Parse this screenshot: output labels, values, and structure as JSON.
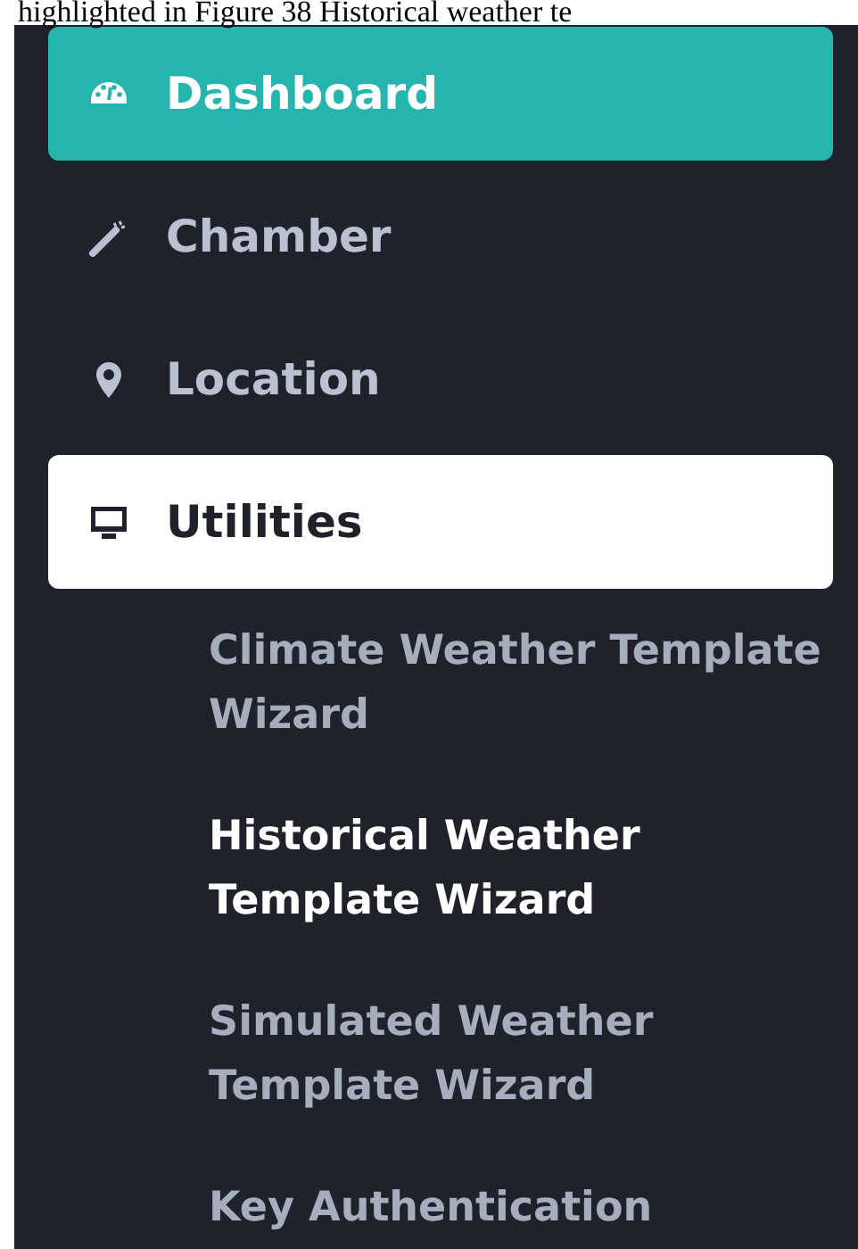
{
  "caption": "highlighted in Figure 38 Historical weather te",
  "sidebar": {
    "items": [
      {
        "label": "Dashboard",
        "selected": true,
        "expanded": false
      },
      {
        "label": "Chamber",
        "selected": false,
        "expanded": false
      },
      {
        "label": "Location",
        "selected": false,
        "expanded": false
      },
      {
        "label": "Utilities",
        "selected": false,
        "expanded": true,
        "children": [
          {
            "label": "Climate Weather Template Wizard",
            "selected": false
          },
          {
            "label": "Historical Weather Template Wizard",
            "selected": true
          },
          {
            "label": "Simulated Weather Template Wizard",
            "selected": false
          },
          {
            "label": "Key Authentication",
            "selected": false
          }
        ]
      }
    ]
  }
}
